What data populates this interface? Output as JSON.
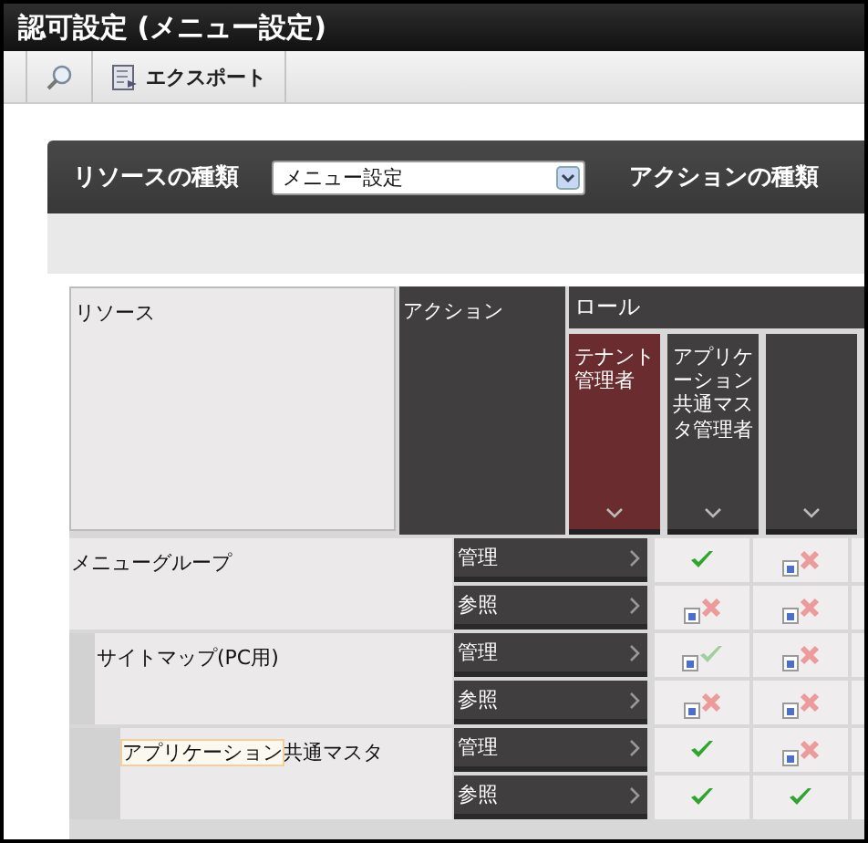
{
  "window": {
    "title": "認可設定 (メニュー設定)"
  },
  "toolbar": {
    "buttons": [
      {
        "kind": "search"
      },
      {
        "kind": "export",
        "label": "エクスポート"
      }
    ]
  },
  "filter": {
    "resource_type_label": "リソースの種類",
    "resource_type_value": "メニュー設定",
    "action_type_label": "アクションの種類"
  },
  "table": {
    "resource_header": "リソース",
    "action_header": "アクション",
    "role_header": "ロール",
    "roles": [
      {
        "label": "テナント管理者",
        "selected": true
      },
      {
        "label": "アプリケーション共通マスタ管理者",
        "selected": false
      },
      {
        "selected": false
      }
    ],
    "resources": [
      {
        "name_parts": [
          {
            "text": "メニューグループ",
            "highlighted": false
          }
        ],
        "actions": [
          {
            "label": "管理",
            "cells": [
              {
                "allowed": true,
                "inherited": false
              },
              {
                "allowed": false,
                "inherited": true
              }
            ]
          },
          {
            "label": "参照",
            "cells": [
              {
                "allowed": false,
                "inherited": true
              },
              {
                "allowed": false,
                "inherited": true
              }
            ]
          }
        ],
        "children": [
          {
            "name_parts": [
              {
                "text": "サイトマップ(PC用)",
                "highlighted": false
              }
            ],
            "actions": [
              {
                "label": "管理",
                "cells": [
                  {
                    "allowed": true,
                    "inherited": true
                  },
                  {
                    "allowed": false,
                    "inherited": true
                  }
                ]
              },
              {
                "label": "参照",
                "cells": [
                  {
                    "allowed": false,
                    "inherited": true
                  },
                  {
                    "allowed": false,
                    "inherited": true
                  }
                ]
              }
            ],
            "children": [
              {
                "name_parts": [
                  {
                    "text": "アプリケーション",
                    "highlighted": true
                  },
                  {
                    "text": "共通マスタ",
                    "highlighted": false
                  }
                ],
                "actions": [
                  {
                    "label": "管理",
                    "cells": [
                      {
                        "allowed": true,
                        "inherited": false
                      },
                      {
                        "allowed": false,
                        "inherited": true
                      }
                    ]
                  },
                  {
                    "label": "参照",
                    "cells": [
                      {
                        "allowed": true,
                        "inherited": false
                      },
                      {
                        "allowed": true,
                        "inherited": false
                      }
                    ]
                  }
                ]
              }
            ]
          }
        ]
      }
    ]
  }
}
